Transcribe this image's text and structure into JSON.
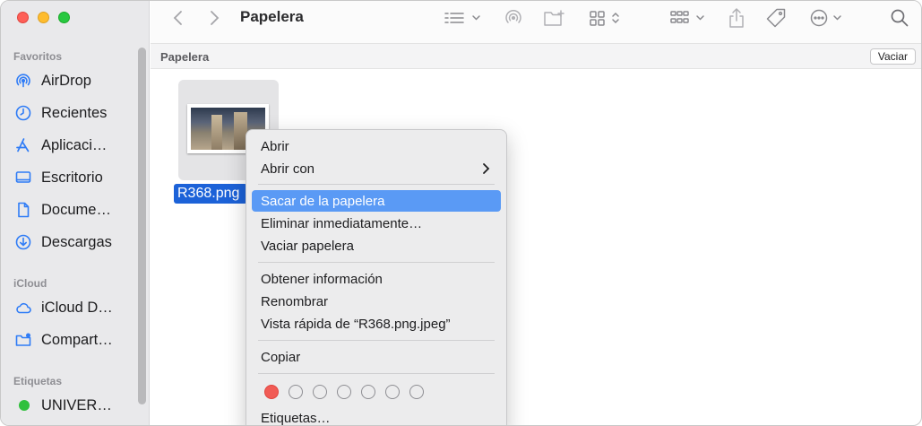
{
  "window": {
    "title": "Papelera"
  },
  "sidebar": {
    "favorites_title": "Favoritos",
    "favorites": [
      {
        "label": "AirDrop",
        "icon": "airdrop-icon"
      },
      {
        "label": "Recientes",
        "icon": "clock-icon"
      },
      {
        "label": "Aplicaci…",
        "icon": "applications-icon"
      },
      {
        "label": "Escritorio",
        "icon": "desktop-icon"
      },
      {
        "label": "Docume…",
        "icon": "document-icon"
      },
      {
        "label": "Descargas",
        "icon": "download-icon"
      }
    ],
    "icloud_title": "iCloud",
    "icloud": [
      {
        "label": "iCloud D…",
        "icon": "cloud-icon"
      },
      {
        "label": "Compart…",
        "icon": "shared-folder-icon"
      }
    ],
    "tags_title": "Etiquetas",
    "tags": [
      {
        "label": "UNIVER…",
        "color": "#30c03c"
      }
    ]
  },
  "pathbar": {
    "label": "Papelera",
    "empty_button": "Vaciar"
  },
  "file": {
    "name": "R368.png"
  },
  "context_menu": {
    "open": "Abrir",
    "open_with": "Abrir con",
    "put_back": "Sacar de la papelera",
    "delete_now": "Eliminar inmediatamente…",
    "empty_trash": "Vaciar papelera",
    "get_info": "Obtener información",
    "rename": "Renombrar",
    "quick_look": "Vista rápida de “R368.png.jpeg”",
    "copy": "Copiar",
    "tags": "Etiquetas…"
  },
  "colors": {
    "accent": "#1c62d8",
    "menu_highlight": "#5a9af5",
    "tag_red": "#f15b55",
    "tag_green": "#30c03c"
  }
}
